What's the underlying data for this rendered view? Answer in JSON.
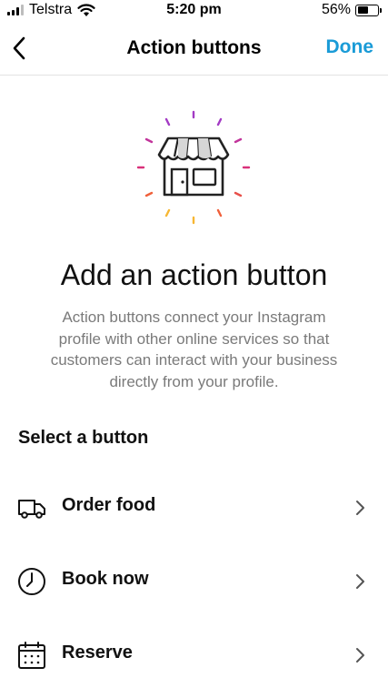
{
  "status_bar": {
    "carrier": "Telstra",
    "time": "5:20 pm",
    "battery_percent": "56%",
    "battery_level": 0.56,
    "icons": [
      "signal-icon",
      "wifi-icon",
      "battery-icon"
    ]
  },
  "nav": {
    "title": "Action buttons",
    "done_label": "Done",
    "back_icon": "chevron-left-icon"
  },
  "hero": {
    "icon": "storefront-icon",
    "headline": "Add an action button",
    "description": "Action buttons connect your Instagram profile with other online services so that customers can interact with your business directly from your profile."
  },
  "select": {
    "heading": "Select a button",
    "options": [
      {
        "label": "Order food",
        "icon": "delivery-truck-icon"
      },
      {
        "label": "Book now",
        "icon": "clock-icon"
      },
      {
        "label": "Reserve",
        "icon": "calendar-icon"
      }
    ]
  },
  "colors": {
    "accent": "#1a9bd7",
    "secondary_text": "#7a7a7a",
    "divider": "#e3e3e3",
    "sparkle_gradient": [
      "#a33bc4",
      "#d9317a",
      "#f0603b",
      "#f7b733"
    ]
  }
}
